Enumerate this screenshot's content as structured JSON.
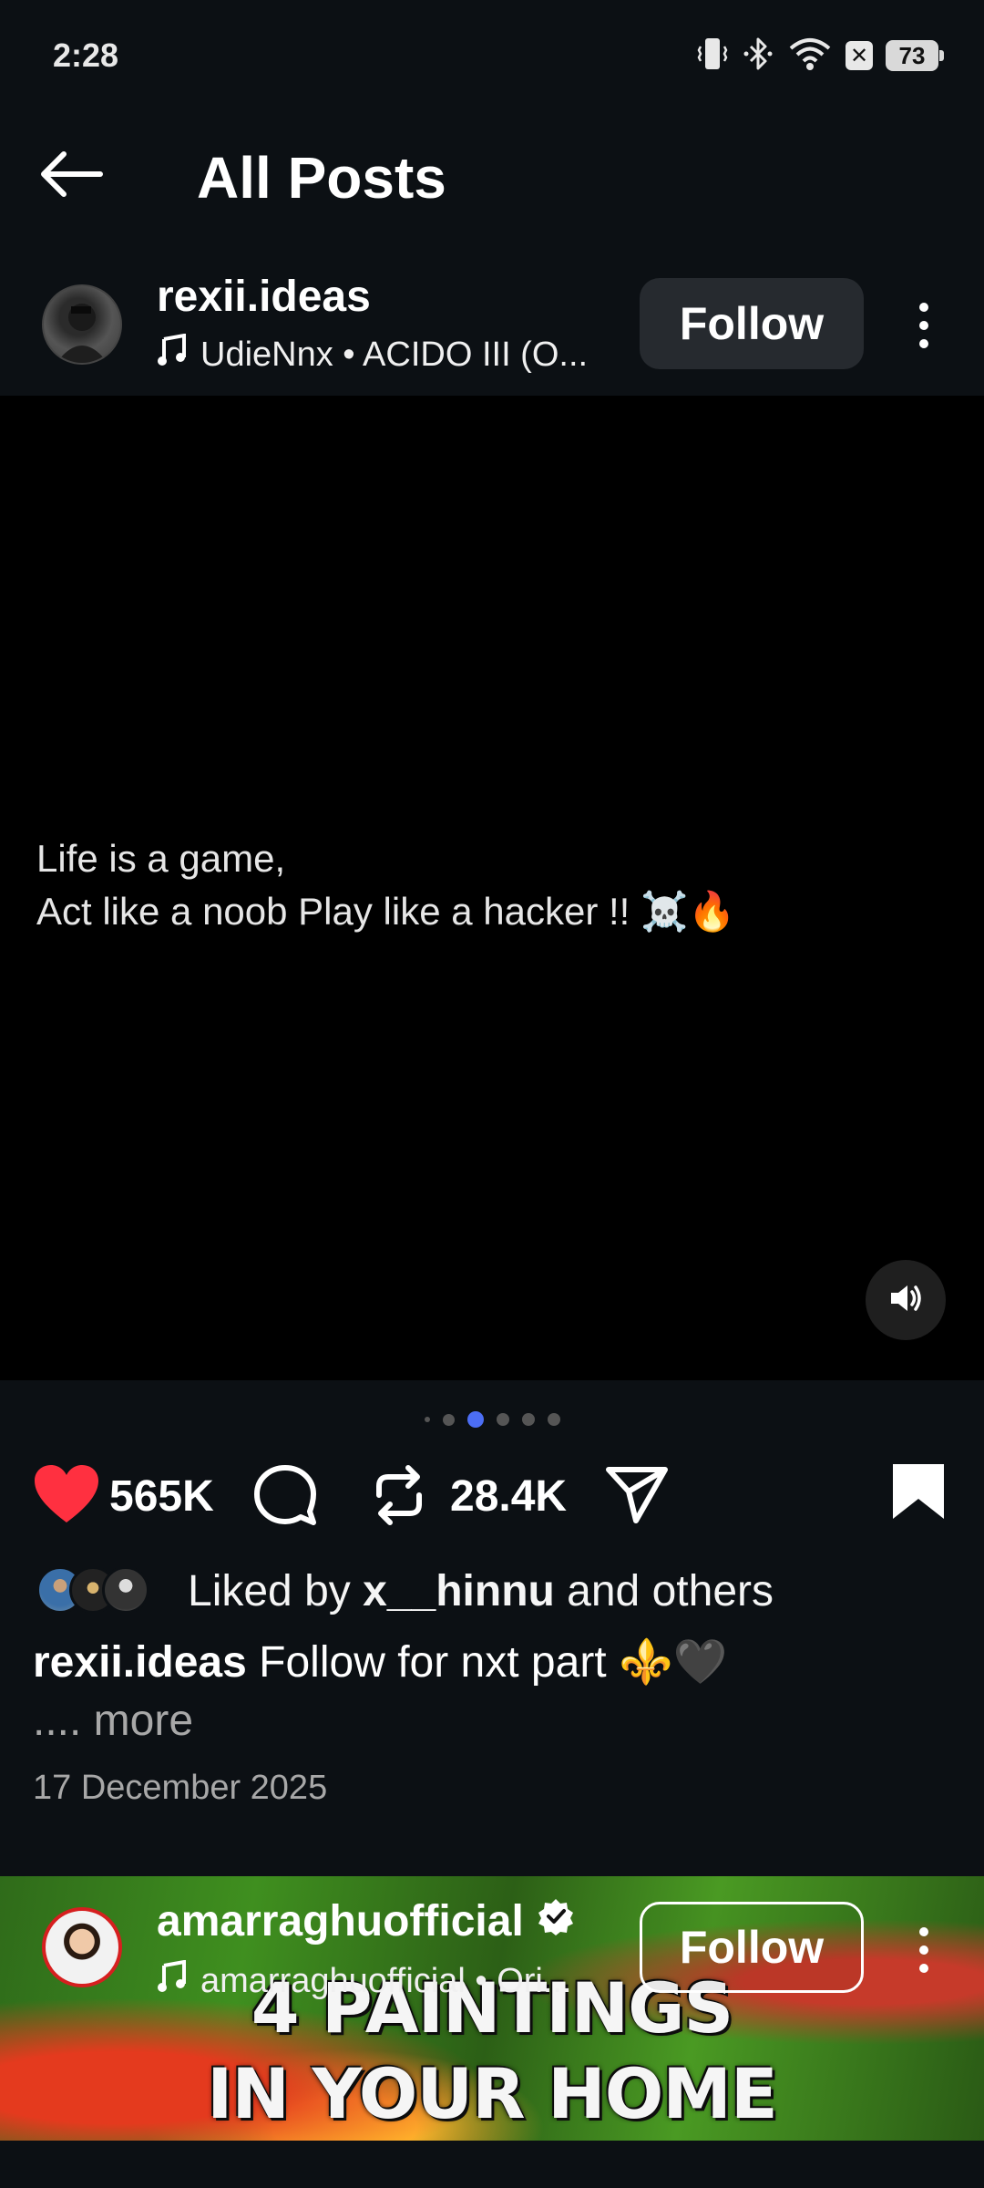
{
  "status_bar": {
    "time": "2:28",
    "battery": "73",
    "icons": [
      "vibrate-icon",
      "bluetooth-icon",
      "wifi-icon",
      "notification-x-icon",
      "battery-icon"
    ]
  },
  "header": {
    "title": "All Posts",
    "back_icon": "arrow-left-icon"
  },
  "post1": {
    "username": "rexii.ideas",
    "music": "UdieNnx • ACIDO III (O...",
    "follow_label": "Follow",
    "media_lines": [
      "Life is a game,",
      "Act like a noob Play like a hacker !! ☠️🔥"
    ],
    "likes_count": "565K",
    "reposts_count": "28.4K",
    "liked_by_prefix": "Liked by ",
    "liked_by_user": "x__hinnu",
    "liked_by_suffix": " and others",
    "caption_user": "rexii.ideas",
    "caption_text": " Follow for nxt part ⚜️🖤",
    "more_label": ".... more",
    "date": "17 December 2025",
    "carousel_active_index": 2,
    "carousel_count": 6
  },
  "post2": {
    "username": "amarraghuofficial",
    "verified": true,
    "music": "amarraghuofficial • Ori...",
    "follow_label": "Follow",
    "overlay_text_line1": "4 PAINTINGS",
    "overlay_text_line2": "IN YOUR HOME"
  },
  "colors": {
    "background": "#0c1014",
    "like_red": "#ff3040",
    "carousel_active": "#4c6ef5",
    "follow_button_bg": "#262a2f",
    "muted_text": "#a8a8a8"
  }
}
